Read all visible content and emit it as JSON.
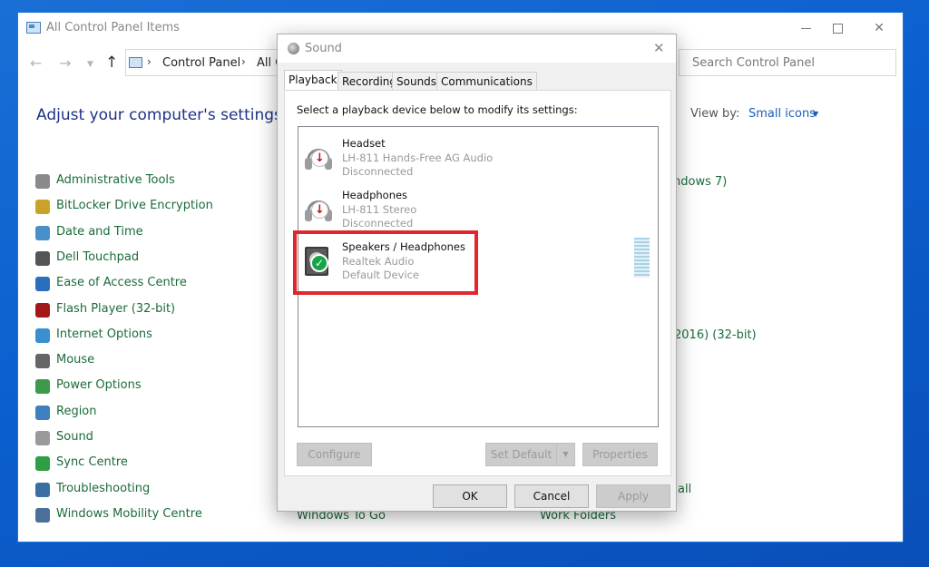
{
  "control_panel": {
    "title": "All Control Panel Items",
    "breadcrumb": {
      "root": "Control Panel",
      "current": "All C"
    },
    "search_placeholder": "Search Control Panel",
    "heading": "Adjust your computer's settings",
    "view_by_label": "View by:",
    "view_by_value": "Small icons",
    "items": [
      {
        "label": "Administrative Tools",
        "icon": "administrative-tools-icon",
        "color": "#8a8a8a"
      },
      {
        "label": "BitLocker Drive Encryption",
        "icon": "bitlocker-icon",
        "color": "#c9a227"
      },
      {
        "label": "Date and Time",
        "icon": "date-time-icon",
        "color": "#4a90c8"
      },
      {
        "label": "Dell Touchpad",
        "icon": "touchpad-icon",
        "color": "#555555"
      },
      {
        "label": "Ease of Access Centre",
        "icon": "ease-of-access-icon",
        "color": "#2a6fbd"
      },
      {
        "label": "Flash Player (32-bit)",
        "icon": "flash-player-icon",
        "color": "#a21818"
      },
      {
        "label": "Internet Options",
        "icon": "internet-options-icon",
        "color": "#3a8fd0"
      },
      {
        "label": "Mouse",
        "icon": "mouse-icon",
        "color": "#666666"
      },
      {
        "label": "Power Options",
        "icon": "power-options-icon",
        "color": "#3c9a4a"
      },
      {
        "label": "Region",
        "icon": "region-icon",
        "color": "#3e7fbf"
      },
      {
        "label": "Sound",
        "icon": "sound-icon",
        "color": "#9a9a9a"
      },
      {
        "label": "Sync Centre",
        "icon": "sync-centre-icon",
        "color": "#2f9e44"
      },
      {
        "label": "Troubleshooting",
        "icon": "troubleshooting-icon",
        "color": "#3a6ea5"
      },
      {
        "label": "Windows Mobility Centre",
        "icon": "mobility-centre-icon",
        "color": "#4b6f9a"
      }
    ],
    "partial_items": {
      "windows7": "ndows 7)",
      "office2016": "2016) (32-bit)",
      "windows_to_go": "Windows To Go",
      "work_folders": "Work Folders",
      "all": "all"
    }
  },
  "dialog": {
    "title": "Sound",
    "tabs": [
      "Playback",
      "Recording",
      "Sounds",
      "Communications"
    ],
    "active_tab": "Playback",
    "instruction": "Select a playback device below to modify its settings:",
    "devices": [
      {
        "name": "Headset",
        "description": "LH-811 Hands-Free AG Audio",
        "status": "Disconnected",
        "badge": "disconnected"
      },
      {
        "name": "Headphones",
        "description": "LH-811 Stereo",
        "status": "Disconnected",
        "badge": "disconnected"
      },
      {
        "name": "Speakers / Headphones",
        "description": "Realtek Audio",
        "status": "Default Device",
        "badge": "default"
      }
    ],
    "buttons": {
      "configure": "Configure",
      "set_default": "Set Default",
      "properties": "Properties",
      "ok": "OK",
      "cancel": "Cancel",
      "apply": "Apply"
    },
    "highlight_color": "#e0272d"
  }
}
